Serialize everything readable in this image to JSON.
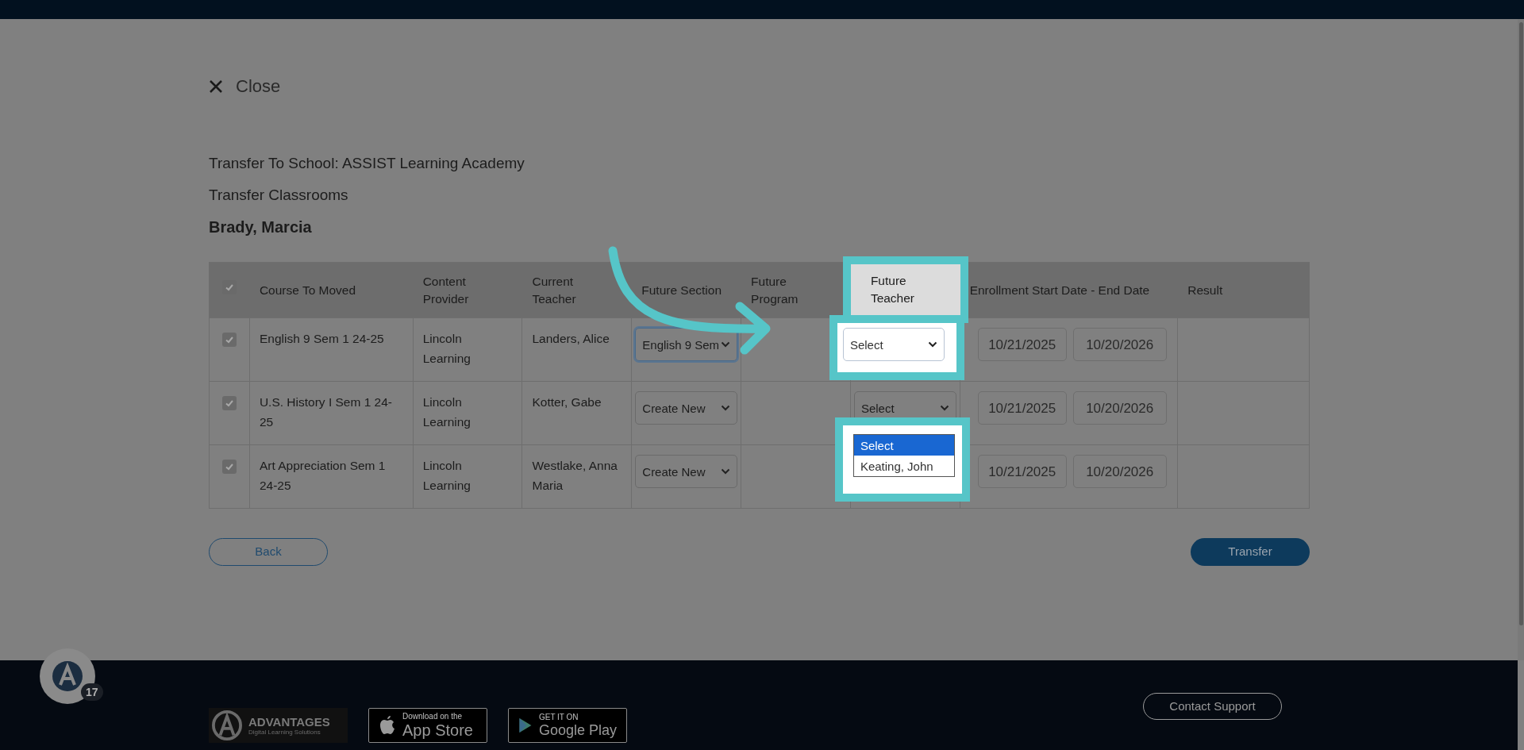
{
  "close": {
    "label": "Close"
  },
  "headings": [
    "Transfer To School: ASSIST Learning Academy",
    "Transfer Classrooms"
  ],
  "student": "Brady, Marcia",
  "table": {
    "select_all": {
      "checked": true
    },
    "columns": [
      "Course To Moved",
      "Content Provider",
      "Current Teacher",
      "Future Section",
      "Future Program",
      "Future Teacher",
      "Enrollment Start Date - End Date",
      "Result"
    ],
    "rows": [
      {
        "checked": true,
        "course": "English 9 Sem 1 24-25",
        "provider": "Lincoln Learning",
        "current_teacher": "Landers, Alice",
        "future_section": "English 9 Sem",
        "section_focused": true,
        "future_teacher": "Select",
        "start_date": "10/21/2025",
        "end_date": "10/20/2026"
      },
      {
        "checked": true,
        "course": "U.S. History I Sem 1 24-25",
        "provider": "Lincoln Learning",
        "current_teacher": "Kotter, Gabe",
        "future_section": "Create New",
        "section_focused": false,
        "future_teacher": "Select",
        "start_date": "10/21/2025",
        "end_date": "10/20/2026",
        "open_options": [
          {
            "label": "Select",
            "selected": true
          },
          {
            "label": "Keating, John",
            "selected": false
          }
        ]
      },
      {
        "checked": true,
        "course": "Art Appreciation Sem 1 24-25",
        "provider": "Lincoln Learning",
        "current_teacher": "Westlake, Anna Maria",
        "future_section": "Create New",
        "section_focused": false,
        "start_date": "10/21/2025",
        "end_date": "10/20/2026"
      }
    ]
  },
  "buttons": {
    "back": "Back",
    "transfer": "Transfer"
  },
  "notification_badge": "17",
  "footer": {
    "brand": "ADVANTAGES",
    "tagline": "Digital Learning Solutions",
    "app_store": {
      "small": "Download on the",
      "large": "App Store"
    },
    "google_play": {
      "small": "GET IT ON",
      "large": "Google Play"
    },
    "contact": "Contact Support"
  }
}
